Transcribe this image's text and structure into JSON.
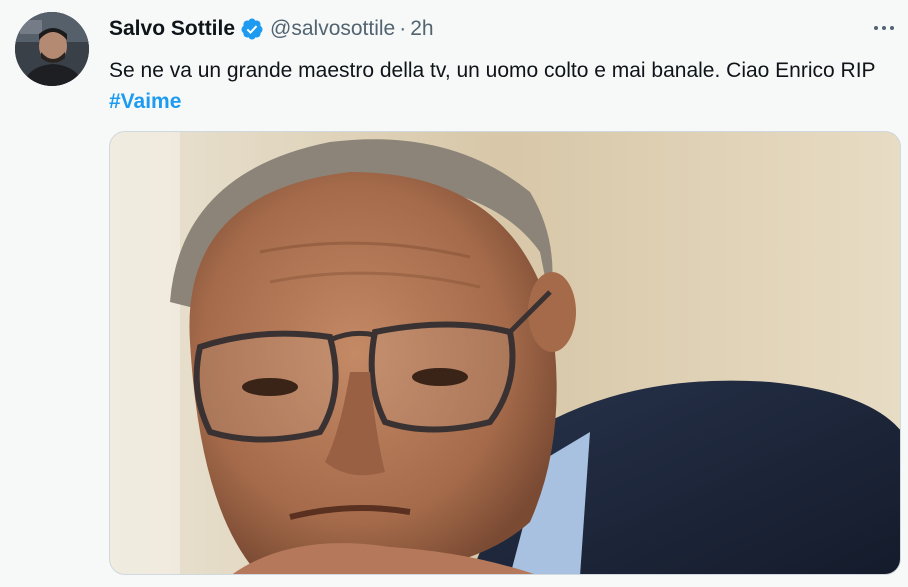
{
  "tweet": {
    "author": {
      "display_name": "Salvo Sottile",
      "handle": "@salvosottile",
      "verified": true,
      "avatar_icon": "profile-photo"
    },
    "separator": "·",
    "timestamp": "2h",
    "more_icon": "more-horizontal-icon",
    "text_before": "Se ne va un grande maestro della tv, un uomo colto e mai banale. Ciao Enrico RIP ",
    "hashtag": "#Vaime",
    "media": {
      "type": "photo"
    }
  },
  "colors": {
    "background": "#f7f9f9",
    "text": "#0f1419",
    "secondary_text": "#536471",
    "accent": "#1d9bf0",
    "border": "#cfd9de"
  }
}
